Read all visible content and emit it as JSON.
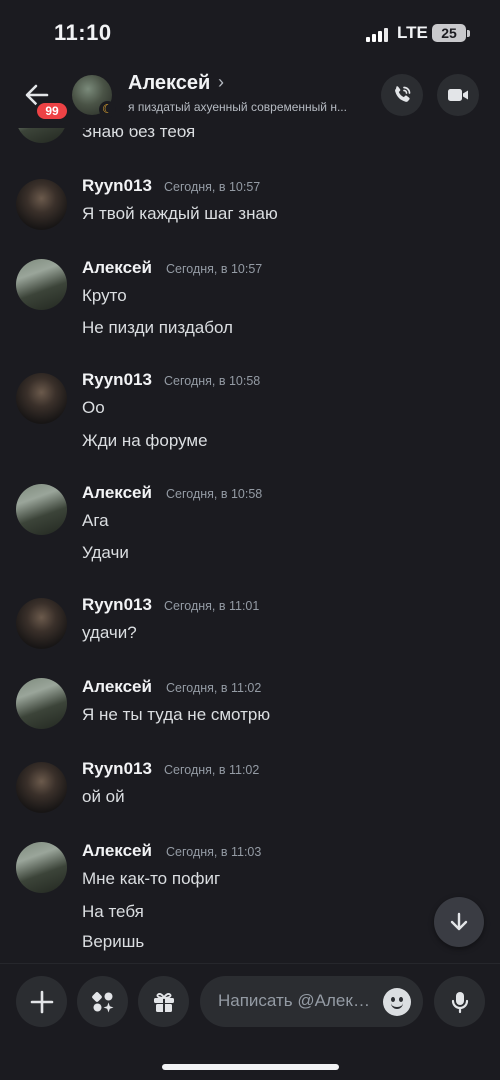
{
  "status_bar": {
    "time": "11:10",
    "network": "LTE",
    "battery": "25"
  },
  "header": {
    "badge_count": "99",
    "name": "Алексей",
    "chevron": "›",
    "status": "я пиздатый ахуенный современный н..."
  },
  "partial_top_line": "Знаю без тебя",
  "messages": [
    {
      "author": "Ryyn013",
      "time": "Сегодня, в 10:57",
      "avatar": "ryyn",
      "lines": [
        "Я твой каждый шаг знаю"
      ]
    },
    {
      "author": "Алексей",
      "time": "Сегодня, в 10:57",
      "avatar": "alexey",
      "lines": [
        "Круто",
        "Не пизди пиздабол"
      ]
    },
    {
      "author": "Ryyn013",
      "time": "Сегодня, в 10:58",
      "avatar": "ryyn",
      "lines": [
        "Оо",
        "Жди на форуме"
      ]
    },
    {
      "author": "Алексей",
      "time": "Сегодня, в 10:58",
      "avatar": "alexey",
      "lines": [
        "Ага",
        "Удачи"
      ]
    },
    {
      "author": "Ryyn013",
      "time": "Сегодня, в 11:01",
      "avatar": "ryyn",
      "lines": [
        "удачи?"
      ]
    },
    {
      "author": "Алексей",
      "time": "Сегодня, в 11:02",
      "avatar": "alexey",
      "lines": [
        "Я не ты туда не смотрю"
      ]
    },
    {
      "author": "Ryyn013",
      "time": "Сегодня, в 11:02",
      "avatar": "ryyn",
      "lines": [
        "ой ой"
      ]
    },
    {
      "author": "Алексей",
      "time": "Сегодня, в 11:03",
      "avatar": "alexey",
      "lines": [
        "Мне как-то пофиг",
        "На тебя",
        "Веришь"
      ]
    }
  ],
  "composer": {
    "placeholder": "Написать @Алексей"
  },
  "colors": {
    "background": "#1b1b20",
    "button": "#2b2d31",
    "badge": "#ed4245",
    "idle": "#f0b232",
    "muted_text": "#949ba4"
  }
}
